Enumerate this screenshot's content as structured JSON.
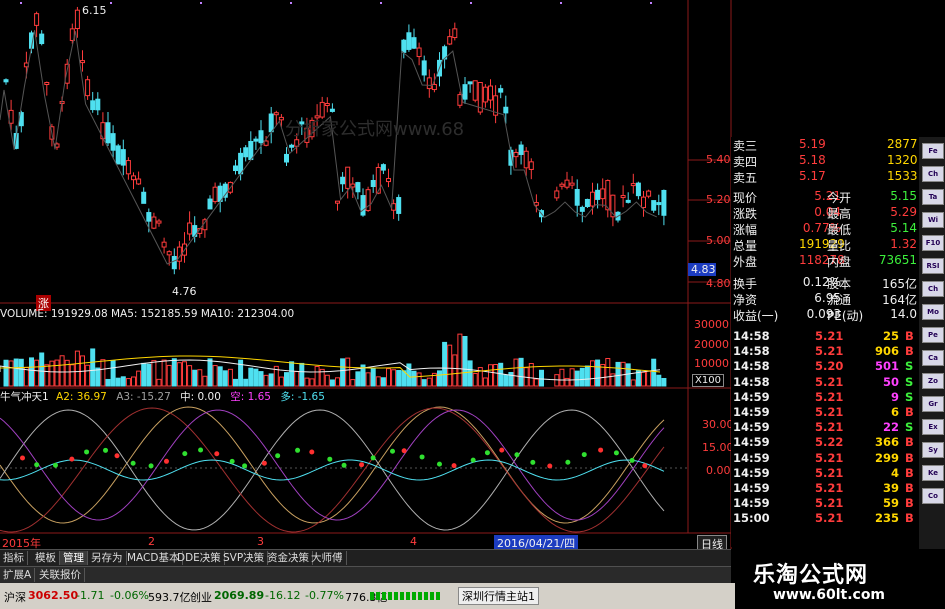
{
  "main": {
    "price_hi_label": "6.15",
    "price_lo_label": "4.76",
    "zhang_label": "涨",
    "price_axis": [
      "5.40",
      "5.20",
      "5.00",
      "4.80"
    ],
    "price_marker": "4.83",
    "volume_info": "VOLUME: 191929.08  MA5: 152185.59  MA10: 212304.00",
    "volume_axis": [
      "30000",
      "20000",
      "10000"
    ],
    "volume_unit": "X100",
    "indicator_info": {
      "name": "牛气冲天1",
      "a2": "A2: 36.97",
      "a3": "A3: -15.27",
      "mid": "中: 0.00",
      "kong": "空: 1.65",
      "duo": "多: -1.65"
    },
    "indicator_axis": [
      "30.00",
      "15.00",
      "0.00"
    ],
    "date_labels": [
      "2015年",
      "2",
      "3",
      "4"
    ],
    "date_highlight": "2016/04/21/四",
    "rixian": "日线",
    "watermark": "分析家公式网www.68"
  },
  "quote": {
    "asks": [
      {
        "label": "卖三",
        "price": "5.19",
        "vol": "2877"
      },
      {
        "label": "卖四",
        "price": "5.18",
        "vol": "1320"
      },
      {
        "label": "卖五",
        "price": "5.17",
        "vol": "1533"
      }
    ],
    "stats": [
      {
        "l1": "现价",
        "v1": "5.21",
        "l2": "今开",
        "v2": "5.15"
      },
      {
        "l1": "涨跌",
        "v1": "0.04",
        "l2": "最高",
        "v2": "5.29"
      },
      {
        "l1": "涨幅",
        "v1": "0.77%",
        "l2": "最低",
        "v2": "5.14"
      },
      {
        "l1": "总量",
        "v1": "191929",
        "l2": "量比",
        "v2": "1.32"
      },
      {
        "l1": "外盘",
        "v1": "118278",
        "l2": "内盘",
        "v2": "73651"
      }
    ],
    "stats2": [
      {
        "l1": "换手",
        "v1": "0.12%",
        "l2": "股本",
        "v2": "165亿"
      },
      {
        "l1": "净资",
        "v1": "6.95",
        "l2": "流通",
        "v2": "164亿"
      },
      {
        "l1": "收益(一)",
        "v1": "0.093",
        "l2": "PE(动)",
        "v2": "14.0"
      }
    ],
    "ticks": [
      {
        "t": "14:58",
        "p": "5.21",
        "v": "25",
        "s": "B"
      },
      {
        "t": "14:58",
        "p": "5.21",
        "v": "906",
        "s": "B"
      },
      {
        "t": "14:58",
        "p": "5.20",
        "v": "501",
        "s": "S"
      },
      {
        "t": "14:58",
        "p": "5.21",
        "v": "50",
        "s": "S"
      },
      {
        "t": "14:59",
        "p": "5.21",
        "v": "9",
        "s": "S"
      },
      {
        "t": "14:59",
        "p": "5.21",
        "v": "6",
        "s": "B"
      },
      {
        "t": "14:59",
        "p": "5.21",
        "v": "22",
        "s": "S"
      },
      {
        "t": "14:59",
        "p": "5.22",
        "v": "366",
        "s": "B"
      },
      {
        "t": "14:59",
        "p": "5.21",
        "v": "299",
        "s": "B"
      },
      {
        "t": "14:59",
        "p": "5.21",
        "v": "4",
        "s": "B"
      },
      {
        "t": "14:59",
        "p": "5.21",
        "v": "39",
        "s": "B"
      },
      {
        "t": "14:59",
        "p": "5.21",
        "v": "59",
        "s": "B"
      },
      {
        "t": "15:00",
        "p": "5.21",
        "v": "235",
        "s": "B"
      }
    ]
  },
  "tabs": [
    "指标",
    "模板",
    "管理",
    "另存为",
    "MACD基本",
    "DDE决策",
    "SVP决策",
    "资金决策",
    "大师傅"
  ],
  "tabs2": [
    "扩展A",
    "关联报价"
  ],
  "status": {
    "sh_name": "沪深",
    "sh_val": "3062.50",
    "sh_chg": "-1.71",
    "sh_pct": "-0.06%",
    "sh_amt": "593.7亿",
    "cy_name": "创业",
    "cy_val": "2069.89",
    "cy_chg": "-16.12",
    "cy_pct": "-0.77%",
    "cy_amt": "776.3亿",
    "station": "深圳行情主站1"
  },
  "brand": {
    "title": "乐淘公式网",
    "url": "www.60lt.com"
  },
  "icons": [
    "Fe",
    "Ch",
    "Ta",
    "Wi",
    "F10",
    "RSI",
    "Ch",
    "Mo",
    "Pe",
    "Ca",
    "Zo",
    "Gr",
    "Ex",
    "Sy",
    "Ke",
    "Co"
  ],
  "colors": {
    "up": "#ff3c3c",
    "down": "#4fe0f0",
    "bg": "#000000",
    "grid": "#8b1a1a"
  }
}
